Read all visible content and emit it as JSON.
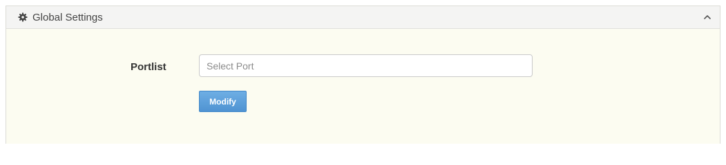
{
  "panel": {
    "title": "Global Settings",
    "header_icon": "gear-icon",
    "collapse_icon": "chevron-up-icon"
  },
  "form": {
    "portlist_label": "Portlist",
    "portlist_value": "",
    "portlist_placeholder": "Select Port",
    "modify_label": "Modify"
  },
  "colors": {
    "panel_bg": "#fcfcf1",
    "header_bg": "#f4f4f3",
    "button_bg": "#5a9fdc"
  }
}
